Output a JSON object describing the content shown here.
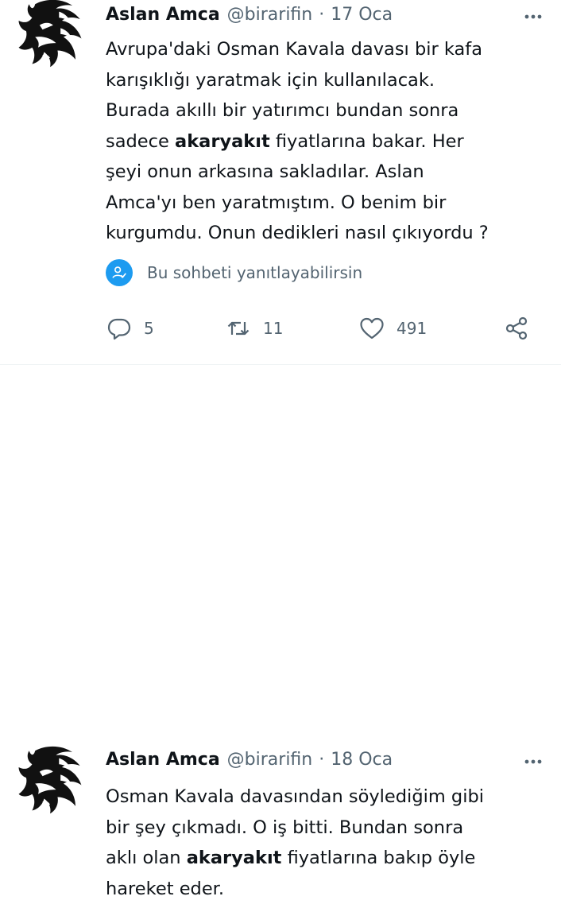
{
  "tweets": [
    {
      "author_name": "Aslan Amca",
      "handle": "@birarifin",
      "separator": "·",
      "date": "17 Oca",
      "lines": [
        {
          "pre": "Avrupa'daki Osman Kavala davası bir kafa",
          "bold": "",
          "post": ""
        },
        {
          "pre": "karışıklığı yaratmak için kullanılacak.",
          "bold": "",
          "post": ""
        },
        {
          "pre": "Burada akıllı bir yatırımcı bundan sonra",
          "bold": "",
          "post": ""
        },
        {
          "pre": "sadece ",
          "bold": "akaryakıt",
          "post": " fiyatlarına bakar. Her"
        },
        {
          "pre": "şeyi onun arkasına sakladılar. Aslan",
          "bold": "",
          "post": ""
        },
        {
          "pre": "Amca'yı ben yaratmıştım. O benim bir",
          "bold": "",
          "post": ""
        },
        {
          "pre": "kurgumdu. Onun dedikleri nasıl çıkıyordu ?",
          "bold": "",
          "post": ""
        }
      ],
      "reply_restriction": "Bu sohbeti yanıtlayabilirsin",
      "reply_count": "5",
      "retweet_count": "11",
      "like_count": "491"
    },
    {
      "author_name": "Aslan Amca",
      "handle": "@birarifin",
      "separator": "·",
      "date": "18 Oca",
      "lines": [
        {
          "pre": "Osman Kavala davasından söylediğim gibi",
          "bold": "",
          "post": ""
        },
        {
          "pre": "bir şey çıkmadı. O iş bitti. Bundan sonra",
          "bold": "",
          "post": ""
        },
        {
          "pre": "aklı olan ",
          "bold": "akaryakıt",
          "post": " fiyatlarına bakıp öyle"
        },
        {
          "pre": "hareket eder.",
          "bold": "",
          "post": ""
        }
      ]
    }
  ],
  "colors": {
    "text": "#0f1419",
    "secondary": "#536471",
    "accent": "#1d9bf0",
    "divider": "#eff3f4"
  },
  "icons": {
    "avatar": "lion-head-logo",
    "more": "more-horizontal-icon",
    "reply_note": "user-check-icon",
    "reply": "reply-bubble-icon",
    "retweet": "retweet-icon",
    "like": "heart-icon",
    "share": "share-icon"
  }
}
